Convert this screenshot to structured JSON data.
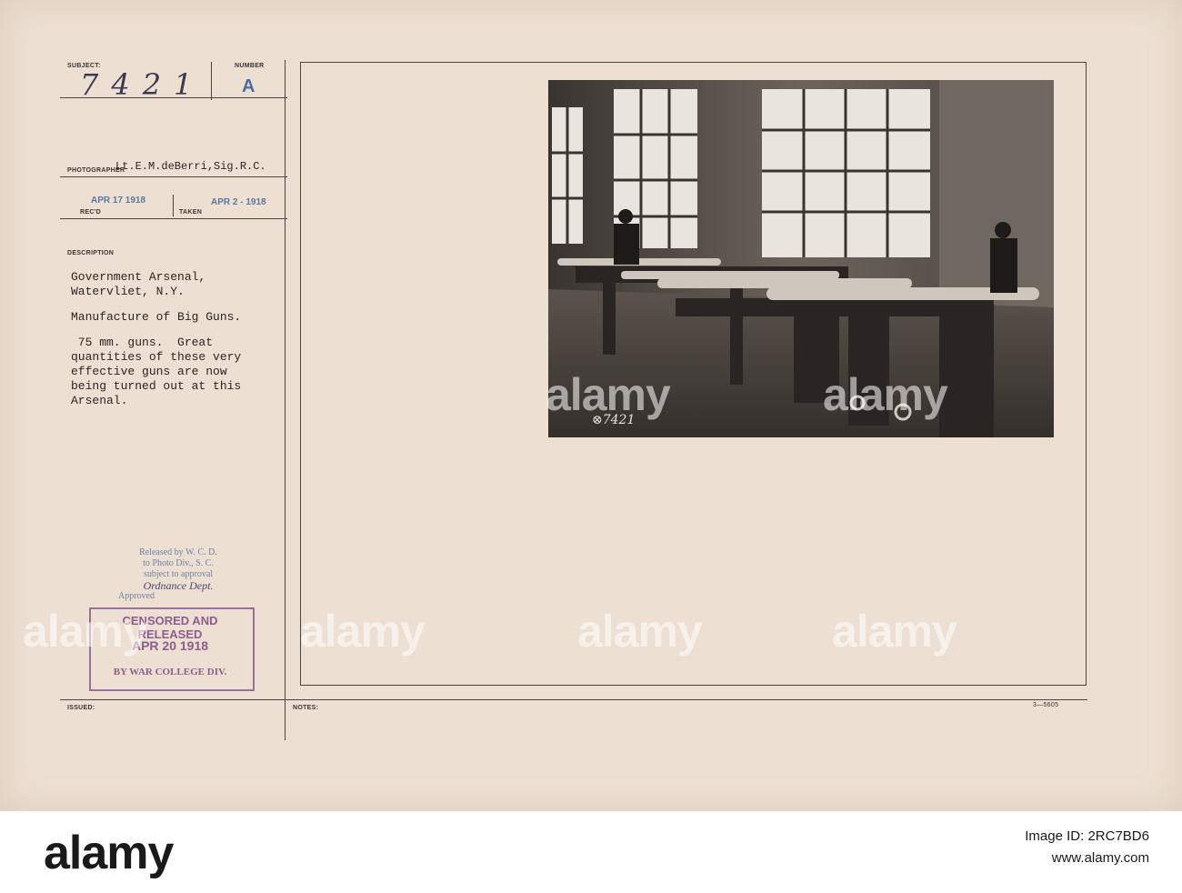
{
  "card": {
    "subject_label": "SUBJECT:",
    "subject_value": "7421",
    "number_label": "NUMBER",
    "number_value": "A",
    "photographer_label": "PHOTOGRAPHER",
    "photographer_value": "Lt.E.M.deBerri,Sig.R.C.",
    "received_stamp": "APR 17 1918",
    "received_label": "REC'D",
    "taken_stamp": "APR 2 - 1918",
    "taken_label": "TAKEN",
    "description_label": "DESCRIPTION",
    "description_lines": [
      "Government Arsenal,",
      "Watervliet, N.Y.",
      "",
      "Manufacture of Big Guns.",
      "",
      " 75 mm. guns.  Great",
      "quantities of these very",
      "effective guns are now",
      "being turned out at this",
      "Arsenal."
    ],
    "release_lines": [
      "Released by W. C. D.",
      "to Photo Div., S. C.",
      "subject to approval",
      "Ordnance Dept.",
      "Approved"
    ],
    "censor_line1": "CENSORED AND RELEASED",
    "censor_date": "APR 20 1918",
    "censor_line3": "BY WAR COLLEGE DIV.",
    "issued_label": "ISSUED:",
    "notes_label": "NOTES:",
    "form_code": "3—5605",
    "photo_negative_number": "⊗7421"
  },
  "watermark": {
    "text": "alamy"
  },
  "footer": {
    "logo": "alamy",
    "image_id_label": "Image ID: 2RC7BD6",
    "url": "www.alamy.com"
  },
  "colors": {
    "card": "#eddfd2",
    "stamp_blue": "#5a78a6",
    "censor_purple": "#8f5c8f"
  }
}
